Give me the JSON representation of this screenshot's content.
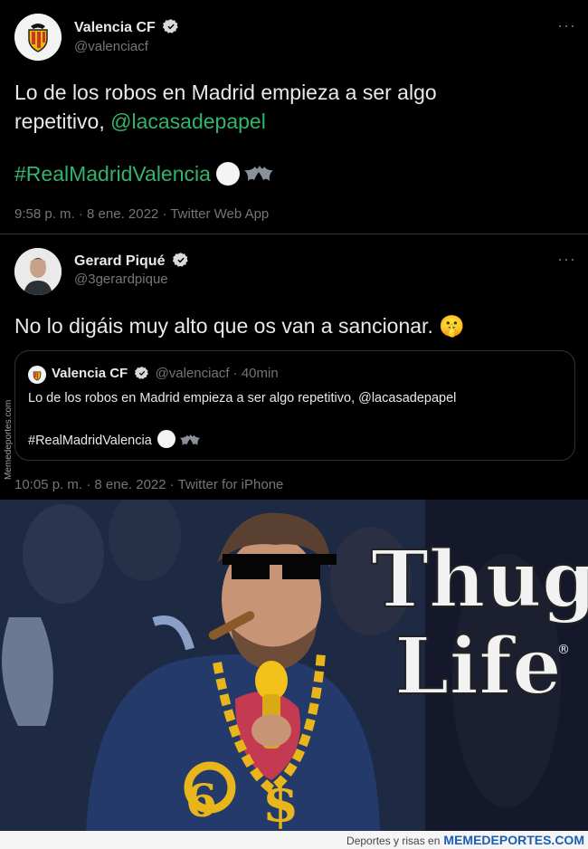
{
  "tweet1": {
    "name": "Valencia CF",
    "handle": "@valenciacf",
    "more": "···",
    "line1": "Lo de los robos en Madrid empieza a ser algo",
    "line2_prefix": "repetitivo, ",
    "mention": "@lacasadepapel",
    "hashtag": "#RealMadridValencia",
    "meta": "9:58 p. m. · 8 ene. 2022 · Twitter Web App"
  },
  "tweet2": {
    "name": "Gerard Piqué",
    "handle": "@3gerardpique",
    "more": "···",
    "text": "No lo digáis muy alto que os van a sancionar.",
    "emoji": "🤫",
    "meta": "10:05 p. m. · 8 ene. 2022 · Twitter for iPhone"
  },
  "quote": {
    "name": "Valencia CF",
    "handle": "@valenciacf · 40min",
    "text": "Lo de los robos en Madrid empieza a ser algo repetitivo, @lacasadepapel",
    "hashtag": "#RealMadridValencia"
  },
  "meme": {
    "title_line1": "Thug",
    "title_line2": "Life",
    "registered": "®",
    "dollar": "$",
    "six": "6"
  },
  "watermark": {
    "side": "Memedeportes.com",
    "footer_prefix": "Deportes y risas en",
    "footer_brand": "MEMEDEPORTES.COM"
  },
  "colors": {
    "background": "#000000",
    "text": "#e7e9ea",
    "secondary": "#71767b",
    "link": "#1d9bf0",
    "hashtag": "#33b36b",
    "verified": "#d9d9d9"
  }
}
